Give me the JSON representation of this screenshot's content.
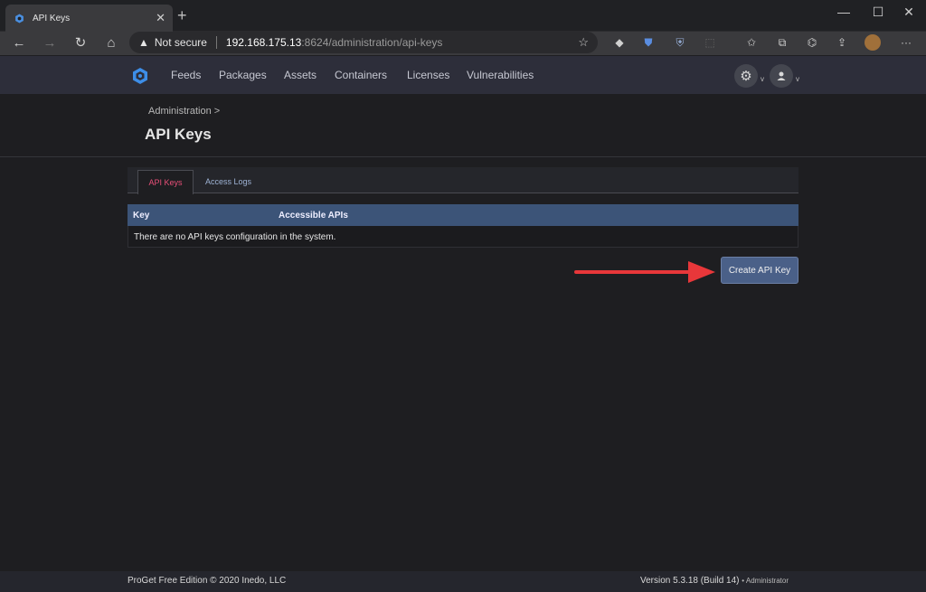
{
  "browser": {
    "tab_title": "API Keys",
    "tab_close": "✕",
    "new_tab": "+",
    "address": {
      "security_label": "Not secure",
      "host": "192.168.175.13",
      "path": ":8624/administration/api-keys"
    },
    "window_controls": {
      "minimize": "—",
      "maximize": "☐",
      "close": "✕"
    }
  },
  "app": {
    "nav": [
      "Feeds",
      "Packages",
      "Assets",
      "Containers",
      "Licenses",
      "Vulnerabilities"
    ]
  },
  "page": {
    "breadcrumb": "Administration >",
    "title": "API Keys",
    "tabs": [
      {
        "label": "API Keys",
        "active": true
      },
      {
        "label": "Access Logs",
        "active": false
      }
    ],
    "table": {
      "columns": [
        "Key",
        "Accessible APIs"
      ],
      "empty_message": "There are no API keys configuration in the system."
    },
    "create_button": "Create API Key"
  },
  "footer": {
    "left": "ProGet Free Edition © 2020 Inedo, LLC",
    "version": "Version 5.3.18 (Build 14)",
    "user": "• Administrator"
  },
  "colors": {
    "accent_tab": "#e84f78",
    "table_header": "#3c5478",
    "button": "#4a6088",
    "arrow": "#e8373a"
  }
}
